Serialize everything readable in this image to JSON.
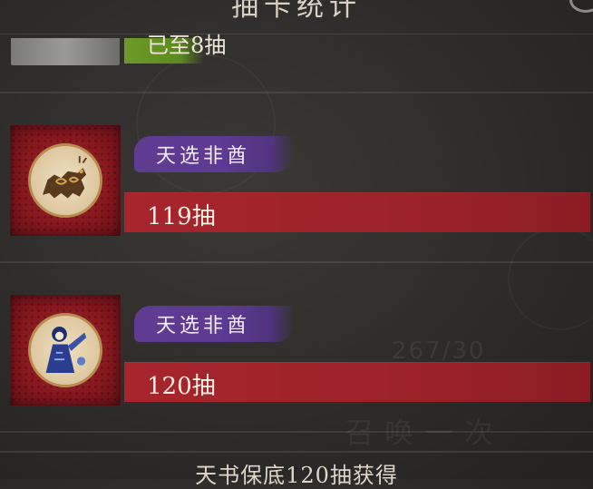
{
  "header": {
    "title": "抽卡统计"
  },
  "top_partial": {
    "text": "已至8抽"
  },
  "entries": [
    {
      "avatar": "qilin-beast-icon",
      "tag": "天选非酋",
      "count": "119抽"
    },
    {
      "avatar": "opera-figure-icon",
      "tag": "天选非酋",
      "count": "120抽"
    }
  ],
  "watermark": {
    "count": "267/30",
    "summon": "召唤一次"
  },
  "footer": {
    "text": "天书保底120抽获得"
  },
  "colors": {
    "tag_purple": "#5d3a93",
    "bar_red": "#a8252c",
    "green_bar": "#6f9a2a"
  }
}
